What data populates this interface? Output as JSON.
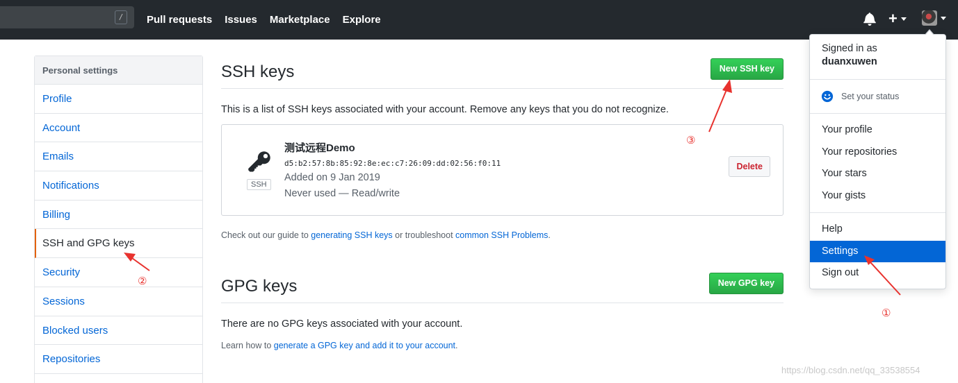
{
  "header": {
    "search_hint": "/",
    "nav": [
      "Pull requests",
      "Issues",
      "Marketplace",
      "Explore"
    ],
    "plus": "+",
    "icons": [
      "bell-icon",
      "plus-icon",
      "avatar"
    ]
  },
  "sidebar": {
    "heading": "Personal settings",
    "items": [
      {
        "label": "Profile"
      },
      {
        "label": "Account"
      },
      {
        "label": "Emails"
      },
      {
        "label": "Notifications"
      },
      {
        "label": "Billing"
      },
      {
        "label": "SSH and GPG keys",
        "selected": true
      },
      {
        "label": "Security"
      },
      {
        "label": "Sessions"
      },
      {
        "label": "Blocked users"
      },
      {
        "label": "Repositories"
      }
    ]
  },
  "ssh": {
    "title": "SSH keys",
    "new_button": "New SSH key",
    "intro": "This is a list of SSH keys associated with your account. Remove any keys that you do not recognize.",
    "key": {
      "name": "测试远程Demo",
      "fingerprint": "d5:b2:57:8b:85:92:8e:ec:c7:26:09:dd:02:56:f0:11",
      "added": "Added on 9 Jan 2019",
      "usage": "Never used — Read/write",
      "type_label": "SSH",
      "delete_button": "Delete"
    },
    "note_prefix": "Check out our guide to ",
    "note_link1": "generating SSH keys",
    "note_middle": " or troubleshoot ",
    "note_link2": "common SSH Problems",
    "note_suffix": "."
  },
  "gpg": {
    "title": "GPG keys",
    "new_button": "New GPG key",
    "empty": "There are no GPG keys associated with your account.",
    "learn_prefix": "Learn how to ",
    "learn_link": "generate a GPG key and add it to your account",
    "learn_suffix": "."
  },
  "dropdown": {
    "signed_in_as": "Signed in as",
    "username": "duanxuwen",
    "status": "Set your status",
    "group1": [
      "Your profile",
      "Your repositories",
      "Your stars",
      "Your gists"
    ],
    "group2": [
      {
        "label": "Help"
      },
      {
        "label": "Settings",
        "active": true
      },
      {
        "label": "Sign out"
      }
    ]
  },
  "annotations": {
    "markers": [
      "①",
      "②",
      "③"
    ],
    "color": "#e8322e"
  },
  "watermark": "https://blog.csdn.net/qq_33538554",
  "colors": {
    "header_bg": "#24292e",
    "link": "#0366d6",
    "green_button": "#28a745",
    "selected_border": "#e36209",
    "active_item": "#0366d6"
  }
}
